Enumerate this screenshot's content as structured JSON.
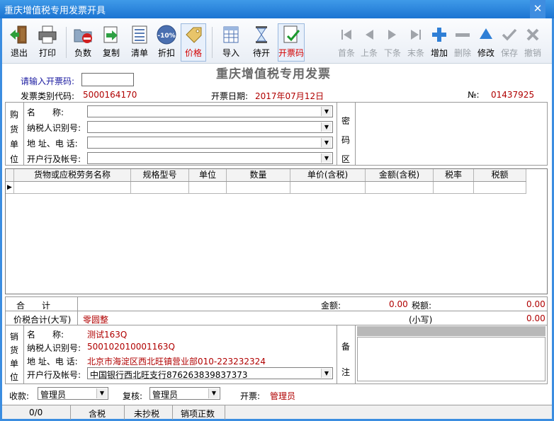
{
  "window": {
    "title": "重庆增值税专用发票开具"
  },
  "toolbar": {
    "exit": "退出",
    "print": "打印",
    "negative": "负数",
    "copy": "复制",
    "list": "清单",
    "discount": "折扣",
    "discount_badge": "-10%",
    "price": "价格",
    "import": "导入",
    "pending": "待开",
    "invoice_code": "开票码",
    "first": "首条",
    "prev": "上条",
    "next": "下条",
    "last": "末条",
    "add": "增加",
    "delete": "删除",
    "modify": "修改",
    "save": "保存",
    "cancel": "撤销"
  },
  "invoice": {
    "enter_code_label": "请输入开票码:",
    "enter_code_value": "",
    "heading": "重庆增值税专用发票",
    "type_code_label": "发票类别代码:",
    "type_code": "5000164170",
    "date_label": "开票日期:",
    "date": "2017年07月12日",
    "number_label": "№:",
    "number": "01437925"
  },
  "buyer": {
    "section": [
      "购",
      "货",
      "单",
      "位"
    ],
    "name_label": "名　　称:",
    "taxid_label": "纳税人识别号:",
    "address_label": "地 址、电 话:",
    "bank_label": "开户行及帐号:",
    "name": "",
    "taxid": "",
    "address": "",
    "bank": ""
  },
  "cipher": {
    "section": [
      "密",
      "码",
      "区"
    ]
  },
  "items": {
    "columns": [
      "货物或应税劳务名称",
      "规格型号",
      "单位",
      "数量",
      "单价(含税)",
      "金额(含税)",
      "税率",
      "税额"
    ],
    "rows": [
      [
        "",
        "",
        "",
        "",
        "",
        "",
        "",
        ""
      ]
    ]
  },
  "totals": {
    "sum_label": "合　　计",
    "amount_label": "金额:",
    "amount": "0.00",
    "tax_label": "税额:",
    "tax": "0.00",
    "total_label": "价税合计(大写)",
    "total_words": "零圆整",
    "small_label": "(小写)",
    "small_value": "0.00"
  },
  "seller": {
    "section": [
      "销",
      "货",
      "单",
      "位"
    ],
    "name_label": "名　　称:",
    "name": "测试163Q",
    "taxid_label": "纳税人识别号:",
    "taxid": "500102010001163Q",
    "address_label": "地 址、电 话:",
    "address": "北京市海淀区西北旺镇营业部010-223232324",
    "bank_label": "开户行及帐号:",
    "bank": "中国银行西北旺支行876263839837373"
  },
  "remarks": {
    "section": [
      "备",
      "注"
    ]
  },
  "footer": {
    "payee_label": "收款:",
    "payee": "管理员",
    "reviewer_label": "复核:",
    "reviewer": "管理员",
    "drawer_label": "开票:",
    "drawer": "管理员"
  },
  "status": {
    "records": "0/0",
    "tax_mode": "含税",
    "copy_state": "未抄税",
    "item_state": "销项正数"
  }
}
